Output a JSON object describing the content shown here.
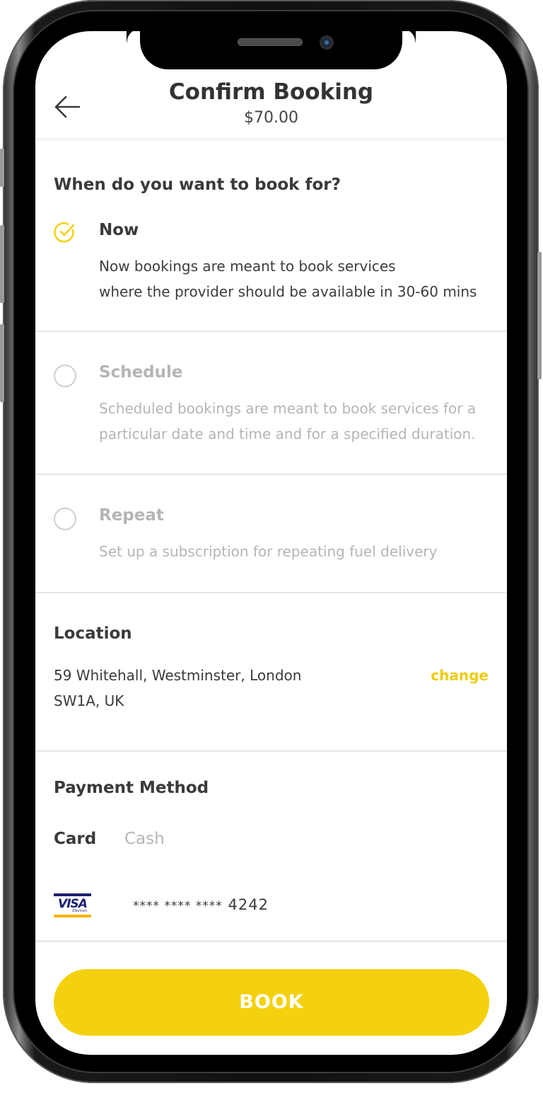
{
  "header": {
    "title": "Confirm Booking",
    "price": "$70.00"
  },
  "booking": {
    "question": "When do you want to book for?",
    "options": [
      {
        "title": "Now",
        "description_lines": [
          "Now bookings are meant to book services",
          "where the provider should be available in 30-60 mins"
        ],
        "selected": true
      },
      {
        "title": "Schedule",
        "description_lines": [
          "Scheduled bookings are meant to book services for a",
          "particular date and time and for a specified duration."
        ],
        "selected": false
      },
      {
        "title": "Repeat",
        "description_lines": [
          "Set up a subscription for repeating fuel delivery"
        ],
        "selected": false
      }
    ]
  },
  "location": {
    "title": "Location",
    "address_lines": [
      "59 Whitehall, Westminster, London",
      "SW1A, UK"
    ],
    "change_label": "change"
  },
  "payment": {
    "title": "Payment Method",
    "tabs": [
      {
        "label": "Card",
        "active": true
      },
      {
        "label": "Cash",
        "active": false
      }
    ],
    "card": {
      "brand": "VISA",
      "brand_sub": "Electron",
      "masked_prefix": "**** **** ****",
      "last4": "4242"
    }
  },
  "actions": {
    "book_label": "BOOK"
  },
  "colors": {
    "accent": "#f4d10e",
    "text": "#3a3a3a",
    "muted": "#b5b5b5",
    "divider": "#e6e6e6"
  },
  "icons": {
    "back": "arrow-left-icon",
    "selected": "check-circle-icon",
    "unselected": "radio-empty-icon",
    "card_brand": "visa-logo-icon"
  }
}
